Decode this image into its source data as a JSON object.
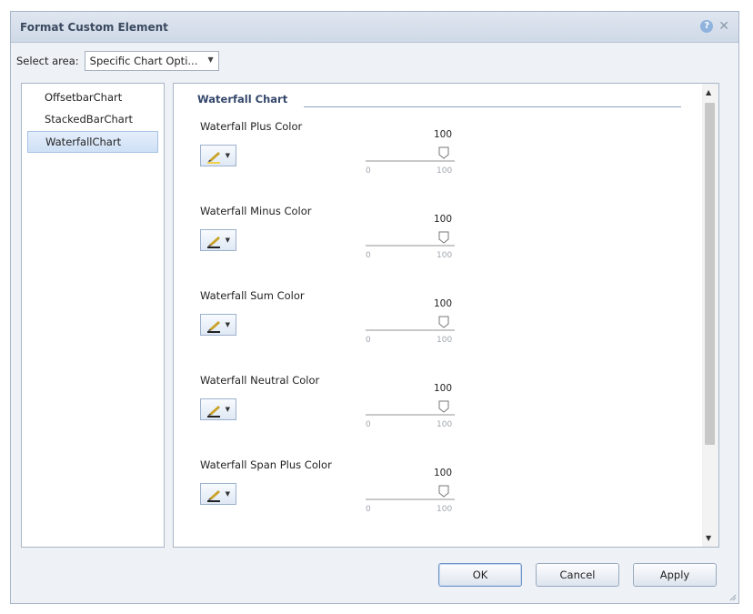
{
  "dialog": {
    "title": "Format Custom Element"
  },
  "area": {
    "label": "Select area:",
    "value": "Specific Chart Opti..."
  },
  "chart_types": [
    {
      "label": "OffsetbarChart",
      "selected": false
    },
    {
      "label": "StackedBarChart",
      "selected": false
    },
    {
      "label": "WaterfallChart",
      "selected": true
    }
  ],
  "section": {
    "title": "Waterfall Chart"
  },
  "colors": [
    {
      "label": "Waterfall Plus Color",
      "transparency": 100,
      "min": "0",
      "max": "100"
    },
    {
      "label": "Waterfall Minus Color",
      "transparency": 100,
      "min": "0",
      "max": "100"
    },
    {
      "label": "Waterfall Sum Color",
      "transparency": 100,
      "min": "0",
      "max": "100"
    },
    {
      "label": "Waterfall Neutral Color",
      "transparency": 100,
      "min": "0",
      "max": "100"
    },
    {
      "label": "Waterfall Span Plus Color",
      "transparency": 100,
      "min": "0",
      "max": "100"
    }
  ],
  "buttons": {
    "ok": "OK",
    "cancel": "Cancel",
    "apply": "Apply"
  },
  "icons": {
    "help": "help-icon",
    "close": "close-icon",
    "brush": "paint-brush-icon"
  },
  "theme": {
    "title_color": "#3b4a60",
    "accent": "#8fb3dd"
  }
}
